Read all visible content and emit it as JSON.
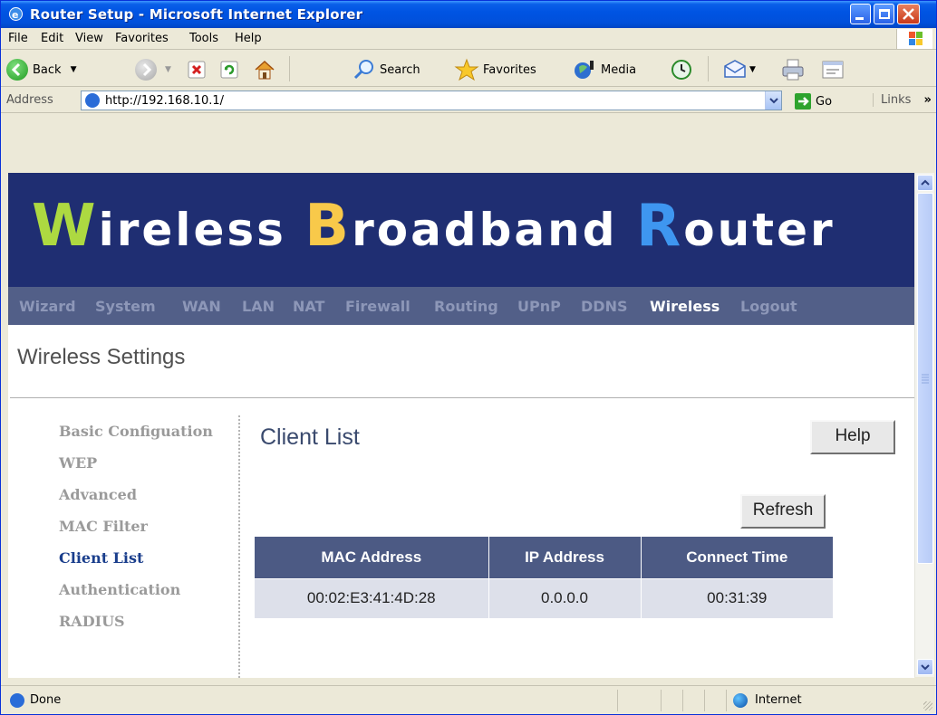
{
  "window": {
    "title": "Router Setup - Microsoft Internet Explorer"
  },
  "menu": [
    "File",
    "Edit",
    "View",
    "Favorites",
    "Tools",
    "Help"
  ],
  "toolbar": {
    "back_label": "Back",
    "search_label": "Search",
    "favorites_label": "Favorites",
    "media_label": "Media"
  },
  "address": {
    "label": "Address",
    "url": "http://192.168.10.1/",
    "go_label": "Go",
    "links_label": "Links"
  },
  "banner": {
    "w_cap": "W",
    "w_rest": "ireless ",
    "b_cap": "B",
    "b_rest": "roadband ",
    "r_cap": "R",
    "r_rest": "outer"
  },
  "nav": [
    "Wizard",
    "System",
    "WAN",
    "LAN",
    "NAT",
    "Firewall",
    "Routing",
    "UPnP",
    "DDNS",
    "Wireless",
    "Logout"
  ],
  "section_title": "Wireless Settings",
  "sidebar": [
    "Basic Configuation",
    "WEP",
    "Advanced",
    "MAC Filter",
    "Client List",
    "Authentication",
    "RADIUS"
  ],
  "content": {
    "title": "Client List",
    "help_label": "Help",
    "refresh_label": "Refresh"
  },
  "table": {
    "headers": [
      "MAC Address",
      "IP Address",
      "Connect Time"
    ],
    "rows": [
      [
        "00:02:E3:41:4D:28",
        "0.0.0.0",
        "00:31:39"
      ]
    ]
  },
  "status": {
    "left": "Done",
    "zone": "Internet"
  },
  "colors": {
    "banner_bg": "#1F2E72",
    "nav_bg": "#525F88",
    "nav_active": "#FFFFFF",
    "table_header": "#4C5A84",
    "table_cell": "#DDE0EA",
    "w_color": "#ADD941",
    "b_color": "#F8C94A",
    "r_color": "#3E96F0"
  }
}
